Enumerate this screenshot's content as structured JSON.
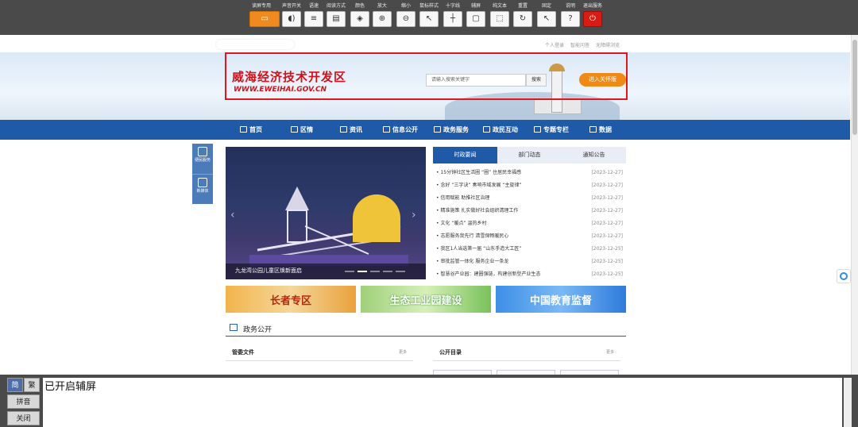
{
  "toolbar": {
    "items": [
      {
        "label": "读屏专用",
        "icon": "monitor-icon",
        "glyph": "▭"
      },
      {
        "label": "声音开关",
        "icon": "sound-icon",
        "glyph": "◖)"
      },
      {
        "label": "语速",
        "icon": "speed-icon",
        "glyph": "≡"
      },
      {
        "label": "阅读方式",
        "icon": "read-mode-icon",
        "glyph": "▤"
      },
      {
        "label": "颜色",
        "icon": "color-icon",
        "glyph": "◈"
      },
      {
        "label": "放大",
        "icon": "zoom-in-icon",
        "glyph": "⊕"
      },
      {
        "label": "缩小",
        "icon": "zoom-out-icon",
        "glyph": "⊖"
      },
      {
        "label": "鼠标样式",
        "icon": "cursor-icon",
        "glyph": "↖"
      },
      {
        "label": "十字线",
        "icon": "crosshair-icon",
        "glyph": "┼"
      },
      {
        "label": "辅屏",
        "icon": "assist-screen-icon",
        "glyph": "▢"
      },
      {
        "label": "纯文本",
        "icon": "text-only-icon",
        "glyph": "⬚"
      },
      {
        "label": "重置",
        "icon": "reset-icon",
        "glyph": "↻"
      },
      {
        "label": "固定",
        "icon": "pin-icon",
        "glyph": "↖"
      },
      {
        "label": "说明",
        "icon": "help-icon",
        "glyph": "?"
      },
      {
        "label": "退出服务",
        "icon": "power-icon",
        "glyph": "⏻"
      }
    ]
  },
  "top_links": [
    "个人登录",
    "智能问答",
    "无障碍浏览"
  ],
  "header": {
    "title": "威海经济技术开发区",
    "url": "WWW.EWEIHAI.GOV.CN",
    "search_placeholder": "请输入搜索关键字",
    "search_button": "搜索",
    "care_button": "进入关怀版"
  },
  "nav": [
    {
      "label": "首页",
      "icon": "home-icon"
    },
    {
      "label": "区情",
      "icon": "district-icon"
    },
    {
      "label": "资讯",
      "icon": "news-icon"
    },
    {
      "label": "信息公开",
      "icon": "info-icon"
    },
    {
      "label": "政务服务",
      "icon": "service-icon"
    },
    {
      "label": "政民互动",
      "icon": "interact-icon"
    },
    {
      "label": "专题专栏",
      "icon": "topic-icon"
    },
    {
      "label": "数据",
      "icon": "data-icon"
    }
  ],
  "side_float": [
    {
      "label": "便民服务",
      "icon": "search-doc-icon"
    },
    {
      "label": "新媒体",
      "icon": "media-icon"
    }
  ],
  "carousel": {
    "caption": "九龙湾公园儿童区焕新面启",
    "dots": 5,
    "active_dot": 2
  },
  "news": {
    "tabs": [
      "时政要闻",
      "部门动态",
      "通知公告"
    ],
    "active_tab": 0,
    "items": [
      {
        "title": "15分钟社区生活圈 “圈” 住居民幸福感",
        "date": "[2023-12-27]"
      },
      {
        "title": "念好 “三字诀” 奏响市域发展 “主旋律”",
        "date": "[2023-12-27]"
      },
      {
        "title": "信用赋能 助推社区治理",
        "date": "[2023-12-27]"
      },
      {
        "title": "精准施策 扎实做好社会组织清理工作",
        "date": "[2023-12-27]"
      },
      {
        "title": "文化 “暖点” 温热乡村",
        "date": "[2023-12-27]"
      },
      {
        "title": "志愿服务我先行 清雪保畅暖民心",
        "date": "[2023-12-27]"
      },
      {
        "title": "我区1人当选第一届 “山东手造大工匠”",
        "date": "[2023-12-25]"
      },
      {
        "title": "审批监管一体化 服务企业一条龙",
        "date": "[2023-12-25]"
      },
      {
        "title": "智慧谷产业园：建圈强链，构建创新型产业生态",
        "date": "[2023-12-25]"
      }
    ]
  },
  "promos": [
    "长者专区",
    "生态工业园建设",
    "中国教育监督"
  ],
  "open_gov": {
    "title": "政务公开",
    "left_header": "管委文件",
    "right_header": "公开目录",
    "more": "更多"
  },
  "assist": {
    "buttons": [
      "简",
      "繁",
      "拼音",
      "关闭"
    ],
    "message": "已开启辅屏"
  },
  "colors": {
    "nav_blue": "#1e5aa8",
    "accent_orange": "#ef8a14",
    "title_red": "#d4101a",
    "exit_red": "#d81c14"
  }
}
